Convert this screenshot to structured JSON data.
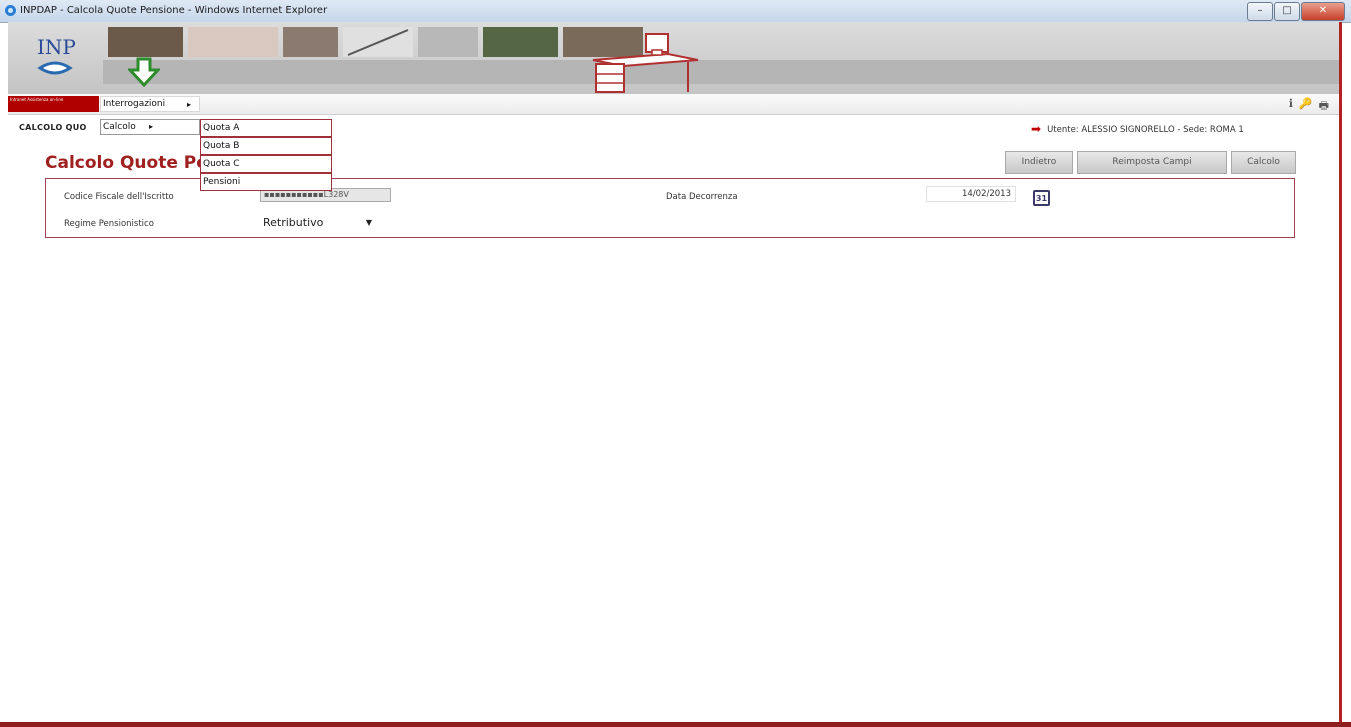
{
  "window": {
    "title": "INPDAP - Calcola Quote Pensione - Windows Internet Explorer",
    "controls": {
      "minimize": "–",
      "maximize": "□",
      "close": "✕"
    }
  },
  "banner": {
    "brand_badge": "Intranet Assistenza on-line"
  },
  "menu": {
    "top_item": "Interrogazioni",
    "arrow": "▸",
    "calcolo": "Calcolo",
    "submenu": [
      "Quota A",
      "Quota B",
      "Quota C",
      "Pensioni"
    ]
  },
  "toolbar_icons": [
    "ℹ",
    "🔑",
    "🖶"
  ],
  "breadcrumb": "CALCOLO QUO",
  "user": {
    "text": "Utente:  ALESSIO SIGNORELLO  - Sede: ROMA 1"
  },
  "page": {
    "title": "Calcolo Quote Pe"
  },
  "buttons": {
    "back": "Indietro",
    "reset": "Reimposta Campi",
    "calc": "Calcolo"
  },
  "form": {
    "cf_label": "Codice Fiscale dell'Iscritto",
    "cf_value": "▪▪▪▪▪▪▪▪▪▪▪L328V",
    "date_label": "Data Decorrenza",
    "date_value": "14/02/2013",
    "cal_icon": "31",
    "regime_label": "Regime Pensionistico",
    "regime_value": "Retributivo",
    "caret": "▼"
  },
  "colors": {
    "brand_red": "#a02020",
    "border_red": "#a04050"
  }
}
